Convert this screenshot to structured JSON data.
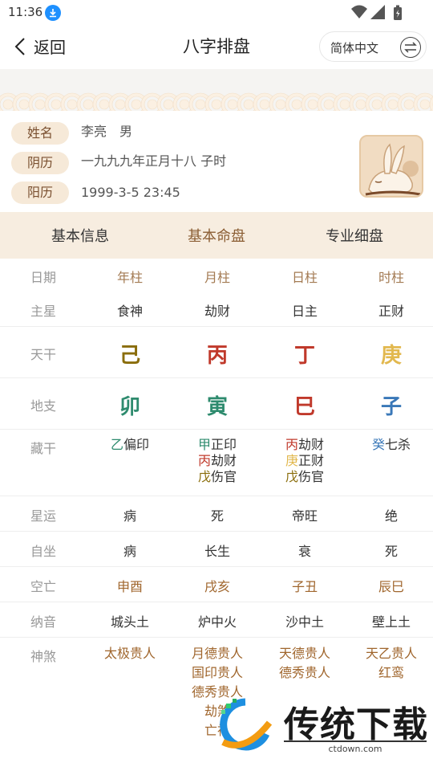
{
  "status_bar": {
    "time": "11:36"
  },
  "nav": {
    "back_label": "返回",
    "title": "八字排盘",
    "language": "简体中文"
  },
  "profile": {
    "rows": [
      {
        "label": "姓名",
        "value": "李亮　男"
      },
      {
        "label": "阴历",
        "value": "一九九九年正月十八 子时"
      },
      {
        "label": "阳历",
        "value": "1999-3-5 23:45"
      }
    ]
  },
  "tabs": [
    "基本信息",
    "基本命盘",
    "专业细盘"
  ],
  "active_tab": 1,
  "table": {
    "header": {
      "label": "日期",
      "cols": [
        "年柱",
        "月柱",
        "日柱",
        "时柱"
      ]
    },
    "zhuxing": {
      "label": "主星",
      "cols": [
        "食神",
        "劫财",
        "日主",
        "正财"
      ]
    },
    "tiangan": {
      "label": "天干",
      "cols": [
        "己",
        "丙",
        "丁",
        "庚"
      ],
      "colors": [
        "#8a6d0b",
        "#c0392b",
        "#c0392b",
        "#e2b84e"
      ]
    },
    "dizhi": {
      "label": "地支",
      "cols": [
        "卯",
        "寅",
        "巳",
        "子"
      ],
      "colors": [
        "#2e8b6e",
        "#2e8b6e",
        "#c0392b",
        "#3a78b8"
      ]
    },
    "canggan": {
      "label": "藏干",
      "cols": [
        [
          {
            "stem": "乙",
            "god": "偏印",
            "color": "#2e8b6e"
          }
        ],
        [
          {
            "stem": "甲",
            "god": "正印",
            "color": "#2e8b6e"
          },
          {
            "stem": "丙",
            "god": "劫财",
            "color": "#c0392b"
          },
          {
            "stem": "戊",
            "god": "伤官",
            "color": "#8a6d0b"
          }
        ],
        [
          {
            "stem": "丙",
            "god": "劫财",
            "color": "#c0392b"
          },
          {
            "stem": "庚",
            "god": "正财",
            "color": "#e2b84e"
          },
          {
            "stem": "戊",
            "god": "伤官",
            "color": "#8a6d0b"
          }
        ],
        [
          {
            "stem": "癸",
            "god": "七杀",
            "color": "#3a78b8"
          }
        ]
      ]
    },
    "xingyun": {
      "label": "星运",
      "cols": [
        "病",
        "死",
        "帝旺",
        "绝"
      ]
    },
    "zizuo": {
      "label": "自坐",
      "cols": [
        "病",
        "长生",
        "衰",
        "死"
      ]
    },
    "kongwang": {
      "label": "空亡",
      "cols": [
        "申酉",
        "戌亥",
        "子丑",
        "辰巳"
      ]
    },
    "nayin": {
      "label": "纳音",
      "cols": [
        "城头土",
        "炉中火",
        "沙中土",
        "壁上土"
      ]
    },
    "shensha": {
      "label": "神煞",
      "cols": [
        [
          "太极贵人"
        ],
        [
          "月德贵人",
          "国印贵人",
          "德秀贵人",
          "劫煞",
          "亡神"
        ],
        [
          "天德贵人",
          "德秀贵人"
        ],
        [
          "天乙贵人",
          "红鸾"
        ]
      ]
    }
  },
  "watermark": {
    "title": "传统下载",
    "url": "ctdown.com"
  },
  "colors": {
    "accent": "#8b5e34",
    "tab_bg": "#f7ede0",
    "pill_bg": "#f6e9d8"
  }
}
